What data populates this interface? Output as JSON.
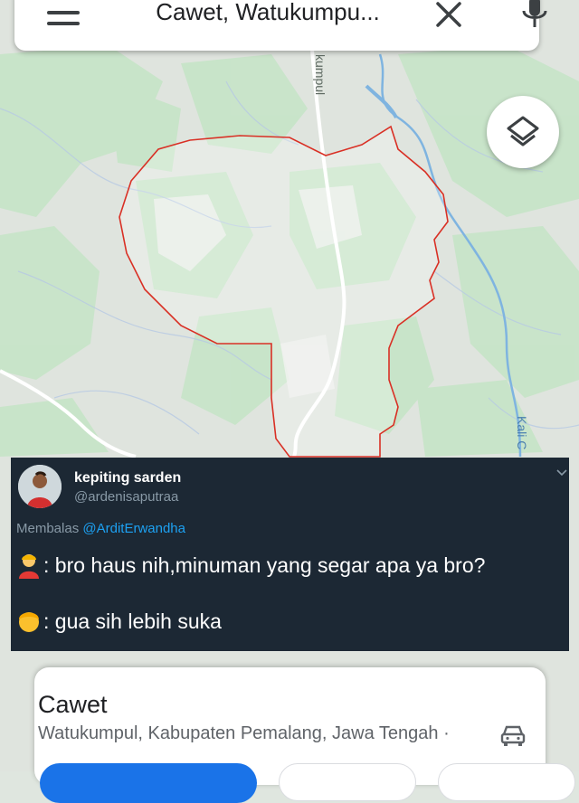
{
  "search": {
    "query": "Cawet, Watukumpu..."
  },
  "map": {
    "road_label": "kumpul",
    "river_label": "Kali C",
    "boundary_color": "#d93025",
    "forest_color": "#c8e6c9",
    "land_color": "#e0e3df",
    "water_color": "#7fb4e0"
  },
  "icons": {
    "menu": "menu-icon",
    "close": "close-icon",
    "mic": "mic-icon",
    "layers": "layers-icon",
    "car": "car-icon"
  },
  "tweet": {
    "name": "kepiting sarden",
    "handle": "@ardenisaputraa",
    "reply_prefix": "Membalas",
    "reply_mention": "@ArditErwandha",
    "lines": [
      {
        "emoji": "person-blond-emoji",
        "text": ": bro haus nih,minuman yang segar apa ya bro?"
      },
      {
        "emoji": "person-blond-face-emoji",
        "text": ": gua sih lebih suka"
      }
    ]
  },
  "place": {
    "title": "Cawet",
    "subtitle": "Watukumpul, Kabupaten Pemalang, Jawa Tengah ·"
  },
  "colors": {
    "accent": "#1a73e8",
    "tweet_bg": "#1c2834",
    "mention": "#1da1f2"
  }
}
